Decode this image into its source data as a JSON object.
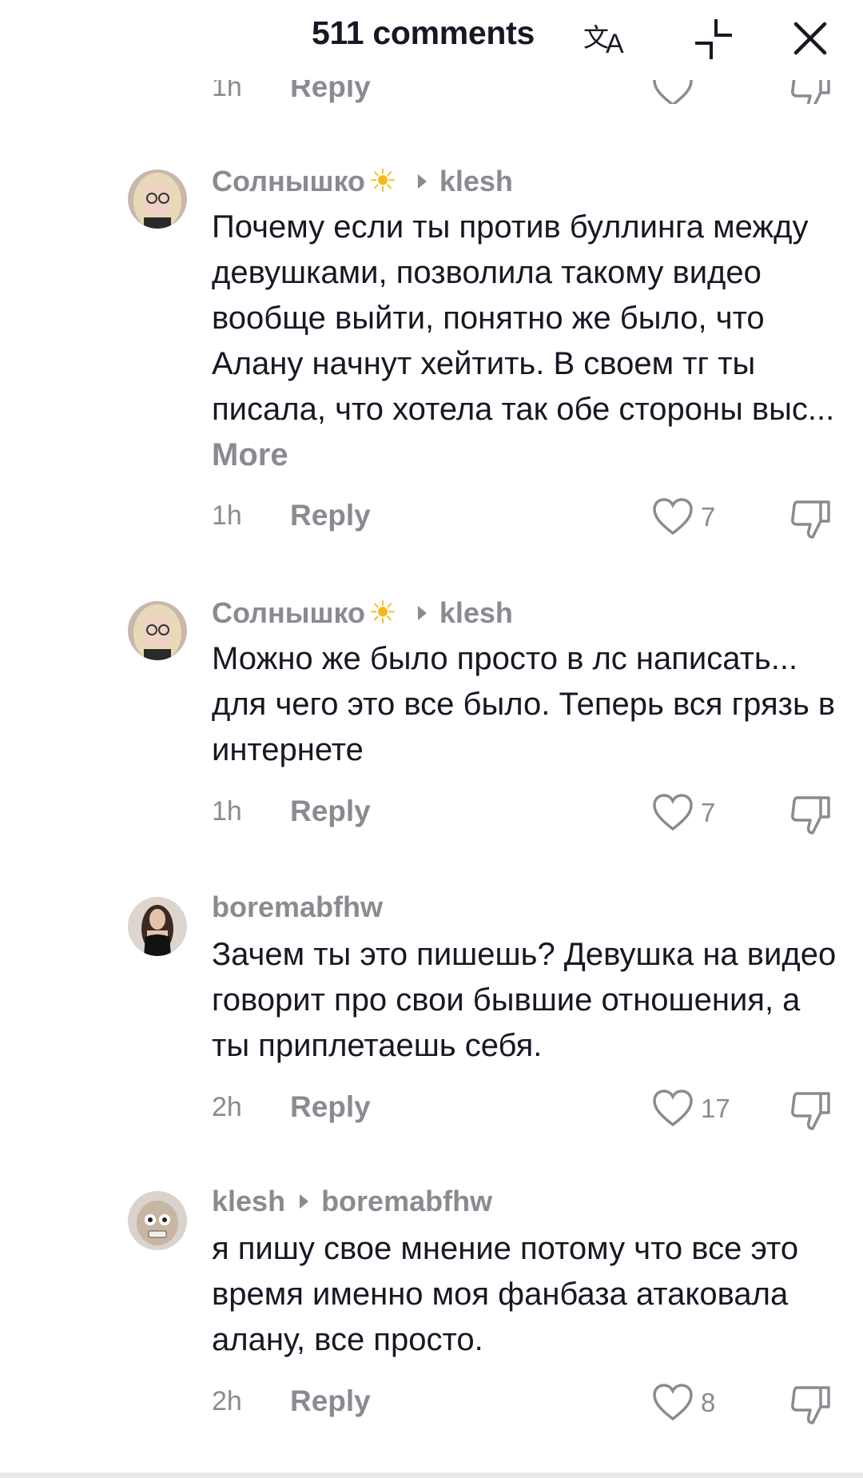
{
  "header": {
    "title": "511 comments",
    "icons": [
      "translate-icon",
      "collapse-icon",
      "close-icon"
    ]
  },
  "peek": {
    "time": "1h",
    "reply": "Reply"
  },
  "comments": [
    {
      "author": "Солнышко",
      "author_emoji": "☀",
      "reply_to": "klesh",
      "text": "Почему если ты против буллинга между девушками, позволила такому видео вообще выйти, понятно же было, что Алану начнут хейтить. В своем тг ты писала, что хотела так обе стороны выс...",
      "more": "More",
      "time": "1h",
      "reply": "Reply",
      "likes": "7"
    },
    {
      "author": "Солнышко",
      "author_emoji": "☀",
      "reply_to": "klesh",
      "text": "Можно же было просто в лс написать... для чего это все было. Теперь вся грязь в интернете",
      "time": "1h",
      "reply": "Reply",
      "likes": "7"
    },
    {
      "author": "boremabfhw",
      "text": "Зачем ты это пишешь? Девушка на видео говорит про свои бывшие отношения, а ты приплетаешь себя.",
      "time": "2h",
      "reply": "Reply",
      "likes": "17"
    },
    {
      "author": "klesh",
      "reply_to": "boremabfhw",
      "text": "я пишу свое мнение потому что все это время именно моя фанбаза атаковала алану, все просто.",
      "time": "2h",
      "reply": "Reply",
      "likes": "8"
    }
  ],
  "colors": {
    "text": "#161823",
    "secondary": "#8a8b91",
    "background": "#ffffff",
    "sun": "#f6b81a"
  }
}
